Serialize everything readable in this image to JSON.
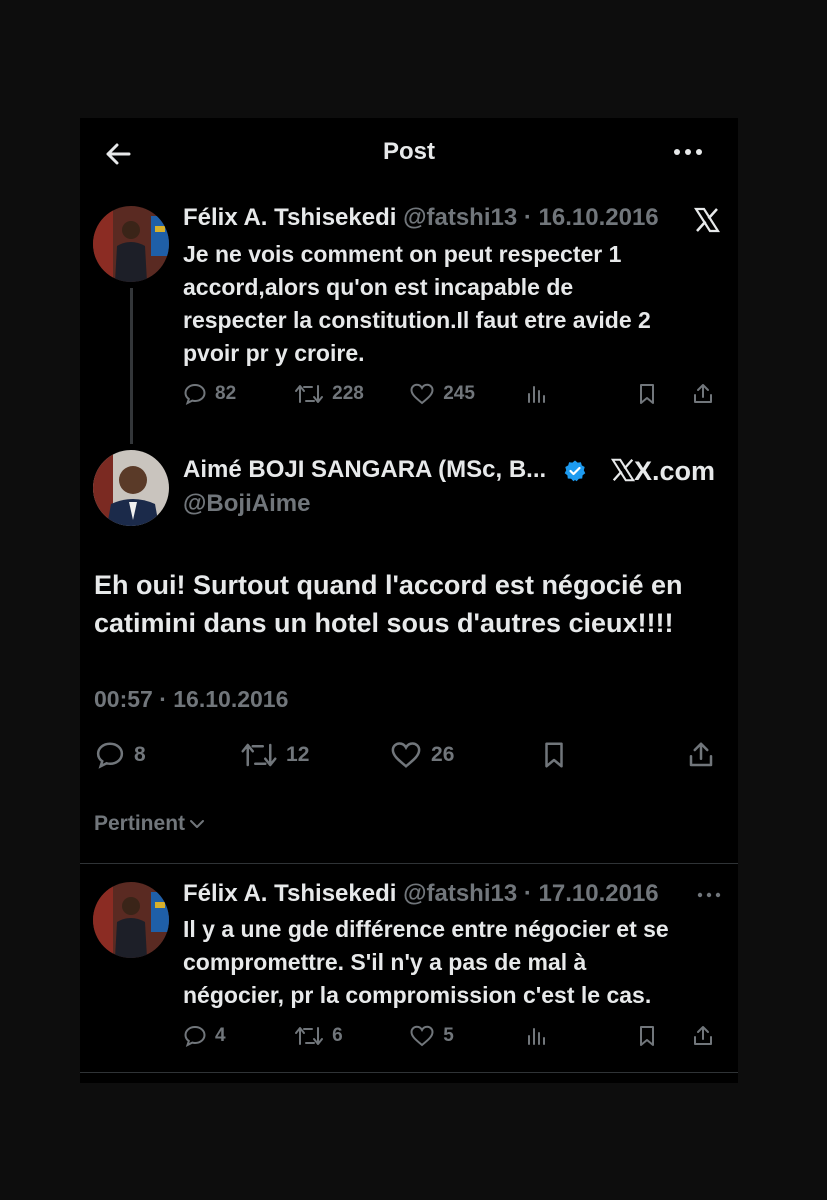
{
  "header": {
    "title": "Post"
  },
  "parent_post": {
    "name": "Félix A. Tshisekedi",
    "handle": "@fatshi13",
    "date": "16.10.2016",
    "text_lines": [
      "Je ne vois comment on peut respecter 1",
      "accord,alors qu'on est incapable de",
      "respecter la constitution.Il faut etre avide 2",
      "pvoir pr y croire."
    ],
    "replies": "82",
    "reposts": "228",
    "likes": "245"
  },
  "main_post": {
    "name": "Aimé BOJI SANGARA (MSc, B...",
    "handle": "@BojiAime",
    "source": "X.com",
    "text_lines": [
      "Eh oui! Surtout quand l'accord est négocié en",
      "catimini dans un hotel sous d'autres cieux!!!!"
    ],
    "timestamp": "00:57 · 16.10.2016",
    "replies": "8",
    "reposts": "12",
    "likes": "26"
  },
  "sort": {
    "label": "Pertinent"
  },
  "reply_post": {
    "name": "Félix A. Tshisekedi",
    "handle": "@fatshi13",
    "date": "17.10.2016",
    "text_lines": [
      "Il y a une gde différence entre négocier et se",
      "compromettre. S'il n'y a pas de mal à",
      "négocier, pr la compromission c'est le cas."
    ],
    "replies": "4",
    "reposts": "6",
    "likes": "5"
  },
  "colors": {
    "background": "#000000",
    "text": "#e7e9ea",
    "muted": "#71767b",
    "verified": "#1d9bf0",
    "divider": "#2f3336"
  }
}
